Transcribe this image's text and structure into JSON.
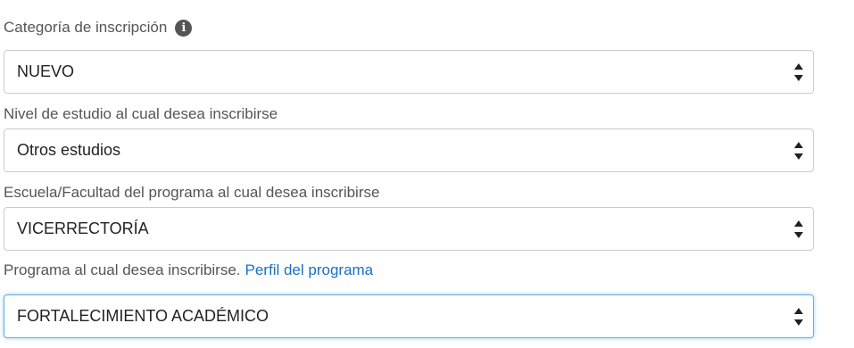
{
  "form": {
    "fields": [
      {
        "label": "Categoría de inscripción",
        "has_info_icon": true,
        "value": "NUEVO"
      },
      {
        "label": "Nivel de estudio al cual desea inscribirse",
        "value": "Otros estudios"
      },
      {
        "label": "Escuela/Facultad del programa al cual desea inscribirse",
        "value": "VICERRECTORÍA"
      },
      {
        "label": "Programa al cual desea inscribirse.",
        "link_text": "Perfil del programa",
        "value": "FORTALECIMIENTO ACADÉMICO",
        "focused": true
      }
    ]
  },
  "colors": {
    "label_text": "#555555",
    "link": "#1a6fc4",
    "border": "#cccccc",
    "focus_border": "#66afe9"
  },
  "icons": {
    "info": "info-circle-icon",
    "select_arrows": "up-down-arrows-icon"
  }
}
